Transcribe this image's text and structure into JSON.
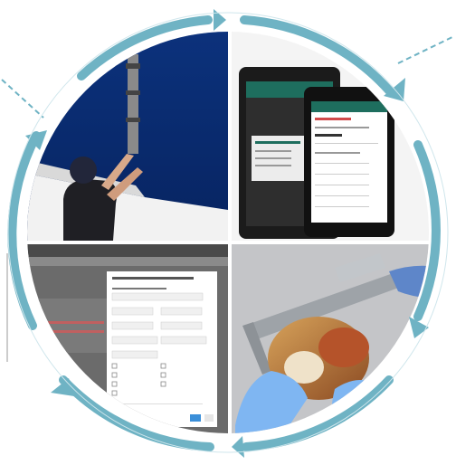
{
  "quadrants": {
    "top_left": {
      "subject": "person-deploying-sampler-from-ship"
    },
    "top_right": {
      "subject": "two-android-tablets-showing-app"
    },
    "bottom_left": {
      "subject": "desktop-web-form-dialog"
    },
    "bottom_right": {
      "subject": "gloved-hands-measuring-shellfish-with-caliper"
    }
  },
  "colors": {
    "ring": "#6fb3c4",
    "ring_dark": "#3f8fa6",
    "ocean": "#0a2a6b",
    "tablet_header": "#1e6e5e",
    "form_accent": "#3b8fd9",
    "glove": "#7fb6f2"
  },
  "icons": [
    "circular-arrow-icon"
  ]
}
